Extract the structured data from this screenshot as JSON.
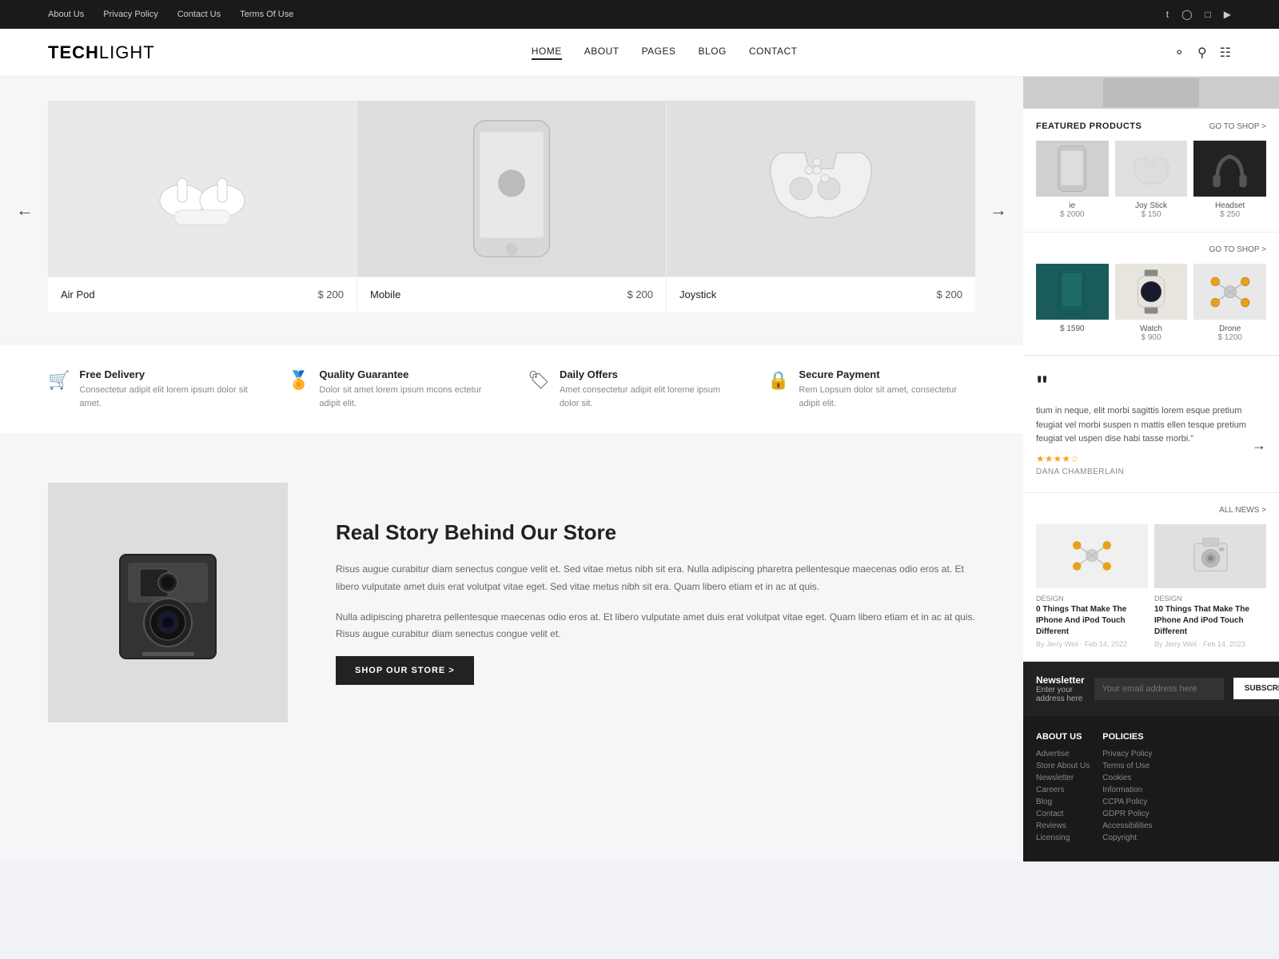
{
  "site": {
    "logo_bold": "TECH",
    "logo_light": "LIGHT"
  },
  "topbar": {
    "links": [
      "About Us",
      "Privacy Policy",
      "Contact Us",
      "Terms Of Use"
    ],
    "social_icons": [
      "f",
      "t",
      "p",
      "in",
      "yt"
    ]
  },
  "nav": {
    "items": [
      {
        "label": "HOME",
        "active": true,
        "has_dropdown": true
      },
      {
        "label": "ABOUT",
        "active": false,
        "has_dropdown": false
      },
      {
        "label": "PAGES",
        "active": false,
        "has_dropdown": true
      },
      {
        "label": "BLOG",
        "active": false,
        "has_dropdown": true
      },
      {
        "label": "CONTACT",
        "active": false,
        "has_dropdown": false
      }
    ]
  },
  "hero_products": [
    {
      "name": "Air Pod",
      "price": "$ 200",
      "img_type": "airpod"
    },
    {
      "name": "Mobile",
      "price": "$ 200",
      "img_type": "mobile"
    },
    {
      "name": "Joystick",
      "price": "$ 200",
      "img_type": "joystick"
    }
  ],
  "features": [
    {
      "icon": "🛒",
      "title": "Free Delivery",
      "desc": "Consectetur adipit elit lorem ipsum dolor sit amet."
    },
    {
      "icon": "🏅",
      "title": "Quality Guarantee",
      "desc": "Dolor sit amet lorem ipsum mcons ectetur adipit elit."
    },
    {
      "icon": "🏷",
      "title": "Daily Offers",
      "desc": "Amet consectetur adipit elit loreme ipsum dolor sit."
    },
    {
      "icon": "🔒",
      "title": "Secure Payment",
      "desc": "Rem Lopsum dolor sit amet, consectetur adipit elit."
    }
  ],
  "about": {
    "title": "Real Story Behind Our Store",
    "para1": "Risus augue curabitur diam senectus congue velit et. Sed vitae metus nibh sit era. Nulla adipiscing pharetra pellentesque maecenas odio eros at. Et libero vulputate amet duis erat volutpat vitae eget. Sed vitae metus nibh sit era. Quam libero etiam et in ac at quis.",
    "para2": "Nulla adipiscing pharetra pellentesque maecenas odio eros at. Et libero vulputate amet duis erat volutpat vitae eget. Quam libero etiam et in ac at quis. Risus augue curabitur diam senectus congue velit et.",
    "cta": "SHOP OUR STORE >"
  },
  "sidebar": {
    "featured": {
      "title": "FEATURED PRODUCTS",
      "go_to": "GO TO SHOP >",
      "row1": [
        {
          "name": "ie",
          "price": "$ 2000",
          "img": "phone"
        },
        {
          "name": "Joy Stick",
          "price": "$ 150",
          "img": "joystick"
        },
        {
          "name": "Headset",
          "price": "$ 250",
          "img": "headset"
        }
      ],
      "go_to2": "GO TO SHOP >",
      "row2": [
        {
          "name": "$ 1590",
          "extra": "",
          "img": "teal"
        },
        {
          "name": "Watch",
          "price": "$ 900",
          "img": "watch"
        },
        {
          "name": "Drone",
          "price": "$ 1200",
          "img": "drone"
        }
      ]
    },
    "testimonial": {
      "quote": "“",
      "text": "tium in neque, elit morbi sagittis lorem esque pretium feugiat vel morbi suspen n mattis ellen tesque pretium feugiat vel uspen dise habi tasse morbi.”",
      "stars": "★★★★☆",
      "author": "DANA CHAMBERLAIN"
    },
    "news": {
      "title": "ALL NEWS >",
      "items": [
        {
          "category": "DESIGN",
          "title": "0 Things That Make The IPhone And iPod Touch Different",
          "meta": "By Jerry Weil · Feb 14, 2022",
          "img": "drone2"
        },
        {
          "category": "DESIGN",
          "title": "10 Things That Make The IPhone And iPod Touch Different",
          "meta": "By Jerry Weil · Feb 14, 2023",
          "img": "camera"
        }
      ]
    },
    "newsletter": {
      "title": "Newsletter",
      "subtitle": "Enter your address here",
      "placeholder": "Your email address here",
      "button": "SUBSCRIBE"
    },
    "footer": {
      "col1": {
        "title": "ABOUT US",
        "links": [
          "Advertise",
          "Store About Us",
          "Newsletter",
          "Careers",
          "Blog",
          "Contact",
          "Reviews",
          "Licensing"
        ]
      },
      "col2": {
        "title": "POLICIES",
        "links": [
          "Privacy Policy",
          "Terms of Use",
          "Cookies",
          "Information",
          "CCPA Policy",
          "GDPR Policy",
          "Accessibilities",
          "Copyright"
        ]
      }
    }
  }
}
